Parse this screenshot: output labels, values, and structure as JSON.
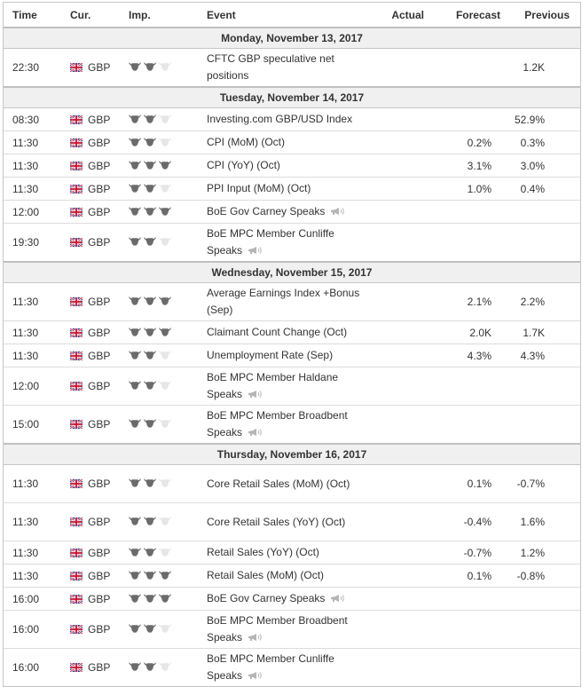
{
  "columns": {
    "time": "Time",
    "currency": "Cur.",
    "importance": "Imp.",
    "event": "Event",
    "actual": "Actual",
    "forecast": "Forecast",
    "previous": "Previous"
  },
  "colors": {
    "bull_active": "#6b6b6b",
    "bull_inactive": "#e6e6e6",
    "day_header_bg": "#f0f0f0"
  },
  "days": [
    {
      "date": "Monday, November 13, 2017",
      "events": [
        {
          "time": "22:30",
          "currency": "GBP",
          "importance": 2,
          "event": "CFTC GBP speculative net positions",
          "speech": false,
          "actual": "",
          "forecast": "",
          "previous": "1.2K"
        }
      ]
    },
    {
      "date": "Tuesday, November 14, 2017",
      "events": [
        {
          "time": "08:30",
          "currency": "GBP",
          "importance": 2,
          "event": "Investing.com GBP/USD Index",
          "speech": false,
          "actual": "",
          "forecast": "",
          "previous": "52.9%"
        },
        {
          "time": "11:30",
          "currency": "GBP",
          "importance": 2,
          "event": "CPI (MoM) (Oct)",
          "speech": false,
          "actual": "",
          "forecast": "0.2%",
          "previous": "0.3%"
        },
        {
          "time": "11:30",
          "currency": "GBP",
          "importance": 3,
          "event": "CPI (YoY) (Oct)",
          "speech": false,
          "actual": "",
          "forecast": "3.1%",
          "previous": "3.0%"
        },
        {
          "time": "11:30",
          "currency": "GBP",
          "importance": 2,
          "event": "PPI Input (MoM) (Oct)",
          "speech": false,
          "actual": "",
          "forecast": "1.0%",
          "previous": "0.4%"
        },
        {
          "time": "12:00",
          "currency": "GBP",
          "importance": 3,
          "event": "BoE Gov Carney Speaks",
          "speech": true,
          "actual": "",
          "forecast": "",
          "previous": ""
        },
        {
          "time": "19:30",
          "currency": "GBP",
          "importance": 2,
          "event": "BoE MPC Member Cunliffe Speaks",
          "speech": true,
          "actual": "",
          "forecast": "",
          "previous": ""
        }
      ]
    },
    {
      "date": "Wednesday, November 15, 2017",
      "events": [
        {
          "time": "11:30",
          "currency": "GBP",
          "importance": 3,
          "event": "Average Earnings Index +Bonus (Sep)",
          "speech": false,
          "actual": "",
          "forecast": "2.1%",
          "previous": "2.2%"
        },
        {
          "time": "11:30",
          "currency": "GBP",
          "importance": 3,
          "event": "Claimant Count Change (Oct)",
          "speech": false,
          "actual": "",
          "forecast": "2.0K",
          "previous": "1.7K"
        },
        {
          "time": "11:30",
          "currency": "GBP",
          "importance": 2,
          "event": "Unemployment Rate (Sep)",
          "speech": false,
          "actual": "",
          "forecast": "4.3%",
          "previous": "4.3%"
        },
        {
          "time": "12:00",
          "currency": "GBP",
          "importance": 2,
          "event": "BoE MPC Member Haldane Speaks",
          "speech": true,
          "actual": "",
          "forecast": "",
          "previous": ""
        },
        {
          "time": "15:00",
          "currency": "GBP",
          "importance": 2,
          "event": "BoE MPC Member Broadbent Speaks",
          "speech": true,
          "actual": "",
          "forecast": "",
          "previous": ""
        }
      ]
    },
    {
      "date": "Thursday, November 16, 2017",
      "events": [
        {
          "time": "11:30",
          "currency": "GBP",
          "importance": 2,
          "event": "Core Retail Sales (MoM) (Oct)",
          "speech": false,
          "actual": "",
          "forecast": "0.1%",
          "previous": "-0.7%"
        },
        {
          "time": "11:30",
          "currency": "GBP",
          "importance": 2,
          "event": "Core Retail Sales (YoY) (Oct)",
          "speech": false,
          "actual": "",
          "forecast": "-0.4%",
          "previous": "1.6%"
        },
        {
          "time": "11:30",
          "currency": "GBP",
          "importance": 2,
          "event": "Retail Sales (YoY) (Oct)",
          "speech": false,
          "actual": "",
          "forecast": "-0.7%",
          "previous": "1.2%"
        },
        {
          "time": "11:30",
          "currency": "GBP",
          "importance": 3,
          "event": "Retail Sales (MoM) (Oct)",
          "speech": false,
          "actual": "",
          "forecast": "0.1%",
          "previous": "-0.8%"
        },
        {
          "time": "16:00",
          "currency": "GBP",
          "importance": 3,
          "event": "BoE Gov Carney Speaks",
          "speech": true,
          "actual": "",
          "forecast": "",
          "previous": ""
        },
        {
          "time": "16:00",
          "currency": "GBP",
          "importance": 2,
          "event": "BoE MPC Member Broadbent Speaks",
          "speech": true,
          "actual": "",
          "forecast": "",
          "previous": ""
        },
        {
          "time": "16:00",
          "currency": "GBP",
          "importance": 2,
          "event": "BoE MPC Member Cunliffe Speaks",
          "speech": true,
          "actual": "",
          "forecast": "",
          "previous": ""
        }
      ]
    }
  ]
}
